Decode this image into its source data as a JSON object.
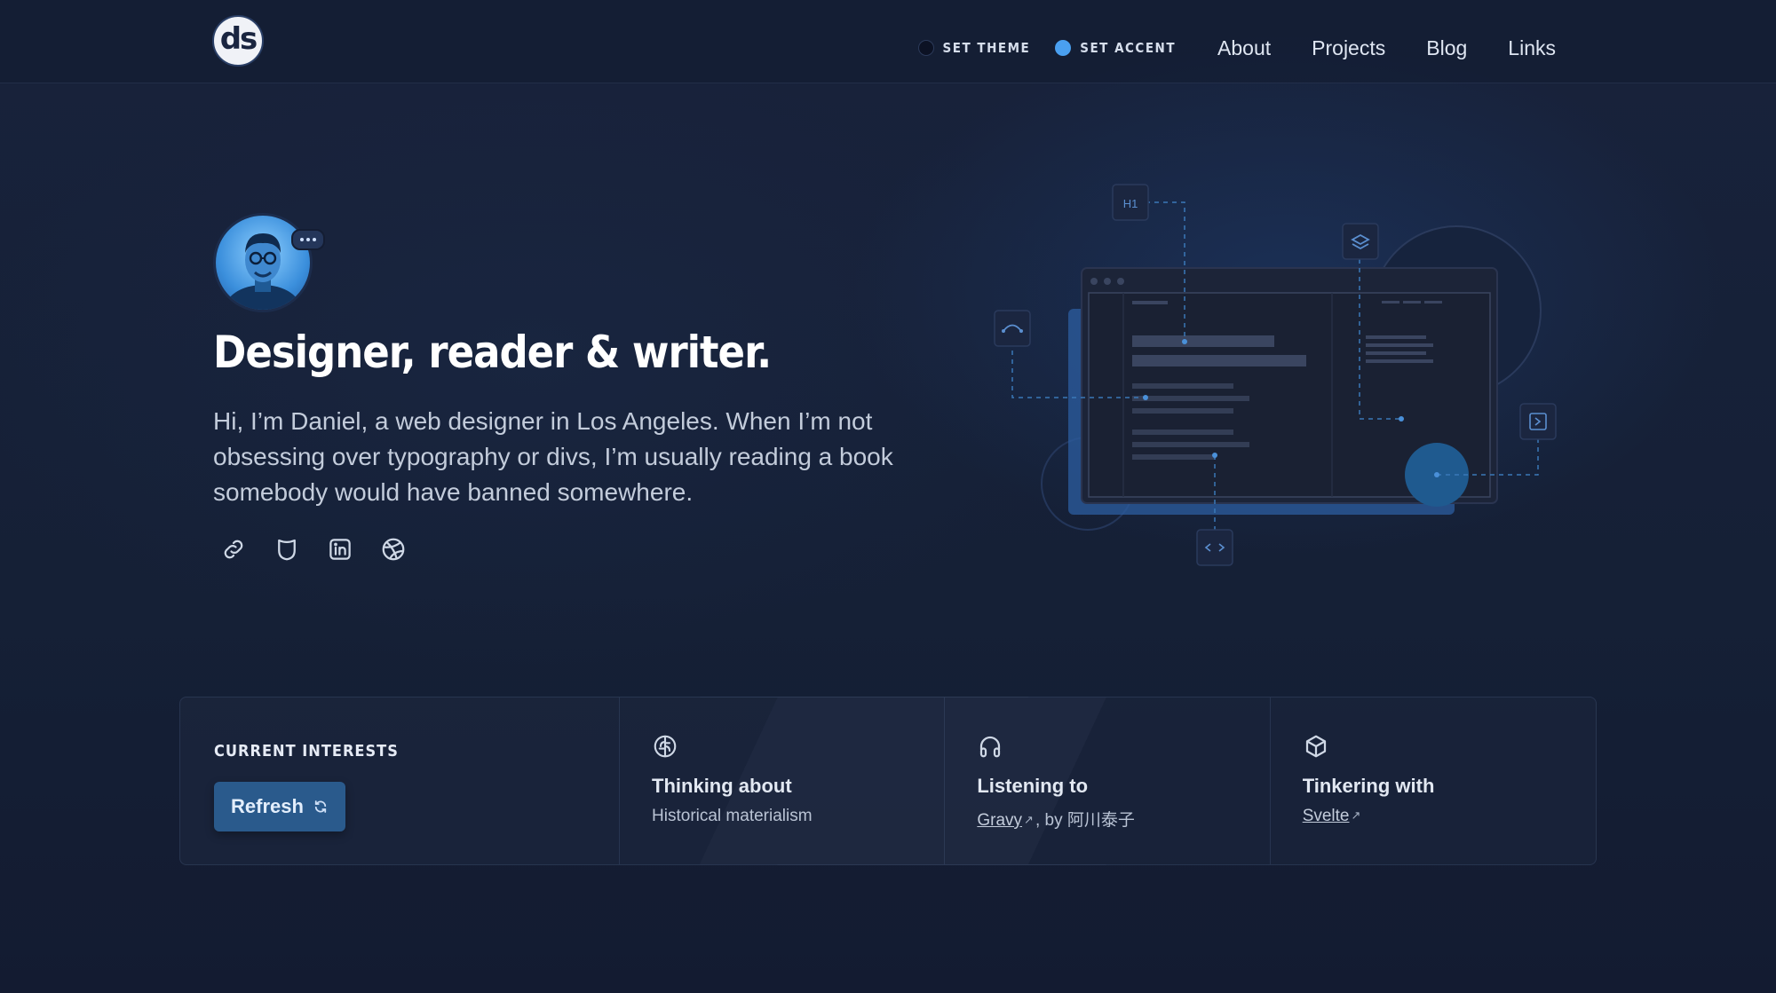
{
  "header": {
    "logo_text": "ds",
    "set_theme_label": "SET THEME",
    "set_accent_label": "SET ACCENT",
    "nav": [
      {
        "label": "About"
      },
      {
        "label": "Projects"
      },
      {
        "label": "Blog"
      },
      {
        "label": "Links"
      }
    ]
  },
  "hero": {
    "title": "Designer, reader & writer.",
    "intro": "Hi, I’m Daniel, a web designer in Los Angeles. When I’m not obsessing over typography or divs, I’m usually reading a book somebody would have banned somewhere.",
    "socials": [
      {
        "icon": "link-icon"
      },
      {
        "icon": "mastodon-icon"
      },
      {
        "icon": "linkedin-icon"
      },
      {
        "icon": "dribbble-icon"
      }
    ],
    "illustration_tag": "H1"
  },
  "interests": {
    "label": "CURRENT INTERESTS",
    "refresh_label": "Refresh",
    "thinking": {
      "title": "Thinking about",
      "value": "Historical materialism"
    },
    "listening": {
      "title": "Listening to",
      "track": "Gravy",
      "by": ", by ",
      "artist": "阿川泰子"
    },
    "tinkering": {
      "title": "Tinkering with",
      "value": "Svelte"
    }
  },
  "colors": {
    "background": "#141d33",
    "accent": "#4aa0f0",
    "button": "#2a5a8c"
  }
}
